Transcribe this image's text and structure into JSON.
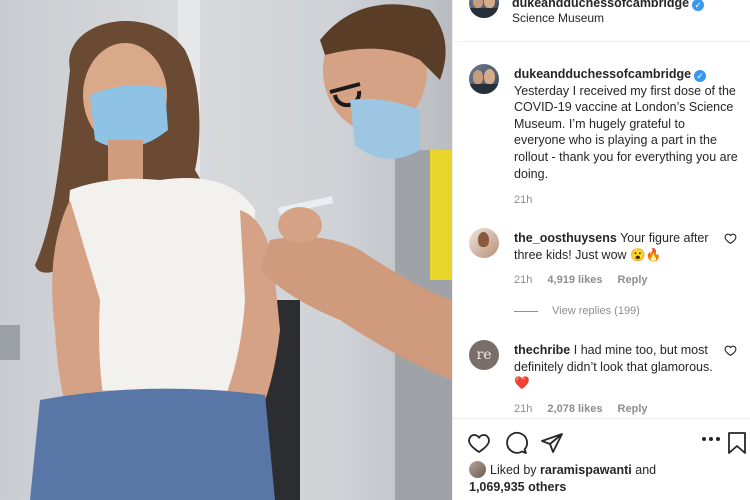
{
  "post": {
    "username": "dukeandduchessofcambridge",
    "verified_mark": "✓",
    "location": "Science Museum",
    "caption": "Yesterday I received my first dose of the COVID-19 vaccine at London’s Science Museum. I’m hugely grateful to everyone who is playing a part in the rollout - thank you for everything you are doing.",
    "caption_time": "21h"
  },
  "comments": [
    {
      "username": "the_oosthuysens",
      "text": "Your figure after three kids! Just wow 😮🔥",
      "time": "21h",
      "likes": "4,919 likes",
      "reply": "Reply",
      "view_replies": "View replies (199)"
    },
    {
      "username": "thechribe",
      "avatar_text": "re",
      "text": "I had mine too, but most definitely didn’t look that glamorous. ❤️",
      "time": "21h",
      "likes": "2,078 likes",
      "reply": "Reply"
    }
  ],
  "likes_summary": {
    "prefix": "Liked by",
    "user": "raramispawanti",
    "conj": "and",
    "count": "1,069,935 others"
  },
  "icons": {
    "like": "heart-icon",
    "comment": "comment-icon",
    "share": "share-icon",
    "more": "more-icon",
    "save": "bookmark-icon"
  },
  "colors": {
    "verified": "#3897f0",
    "meta_text": "#8e8e8e",
    "like_heart": "#ed4956",
    "mask": "#8ec3e6"
  }
}
